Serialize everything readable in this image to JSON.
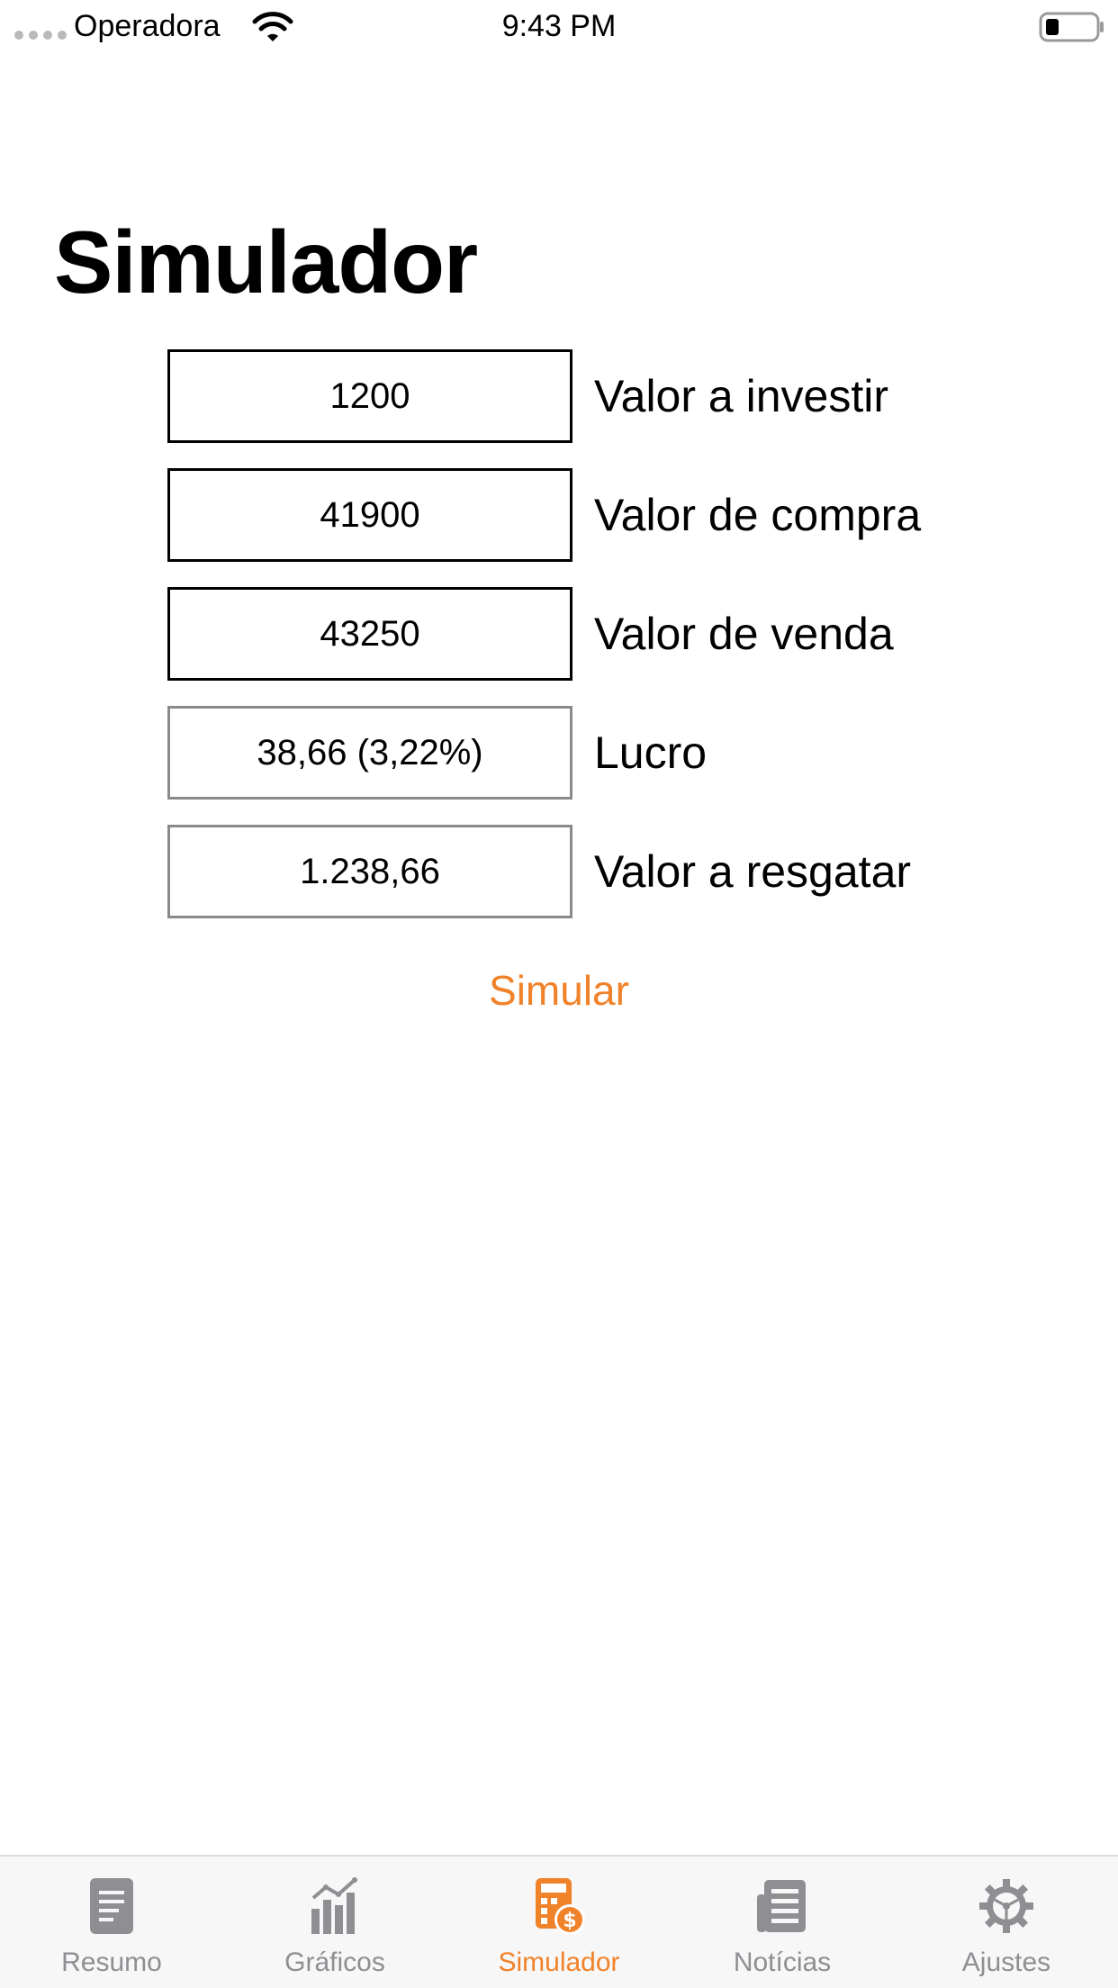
{
  "status_bar": {
    "carrier": "Operadora",
    "time": "9:43 PM"
  },
  "page": {
    "title": "Simulador"
  },
  "form": {
    "rows": [
      {
        "value": "1200",
        "label": "Valor a investir"
      },
      {
        "value": "41900",
        "label": "Valor de compra"
      },
      {
        "value": "43250",
        "label": "Valor de venda"
      },
      {
        "value": "38,66 (3,22%)",
        "label": "Lucro"
      },
      {
        "value": "1.238,66",
        "label": "Valor a resgatar"
      }
    ],
    "simulate_label": "Simular"
  },
  "tab_bar": {
    "tabs": [
      {
        "label": "Resumo",
        "icon": "document-icon"
      },
      {
        "label": "Gráficos",
        "icon": "chart-icon"
      },
      {
        "label": "Simulador",
        "icon": "calculator-icon"
      },
      {
        "label": "Notícias",
        "icon": "newspaper-icon"
      },
      {
        "label": "Ajustes",
        "icon": "gear-icon"
      }
    ],
    "active_tab": "Simulador"
  },
  "colors": {
    "accent": "#f0822a",
    "inactive": "#8e8e93",
    "text": "#000000"
  }
}
